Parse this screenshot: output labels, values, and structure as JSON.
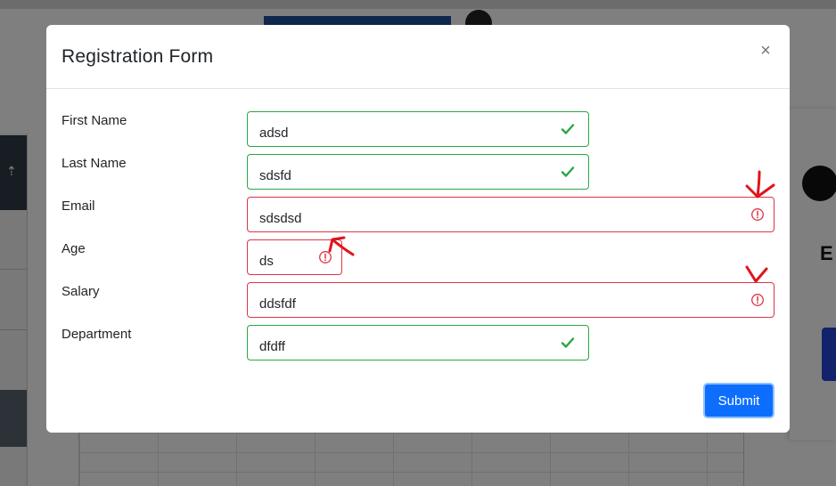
{
  "modal": {
    "title": "Registration Form",
    "close_label": "×",
    "submit_label": "Submit"
  },
  "fields": {
    "first_name": {
      "label": "First Name",
      "value": "adsd",
      "status": "valid"
    },
    "last_name": {
      "label": "Last Name",
      "value": "sdsfd",
      "status": "valid"
    },
    "email": {
      "label": "Email",
      "value": "sdsdsd",
      "status": "invalid"
    },
    "age": {
      "label": "Age",
      "value": "ds",
      "status": "invalid"
    },
    "salary": {
      "label": "Salary",
      "value": "ddsfdf",
      "status": "invalid"
    },
    "department": {
      "label": "Department",
      "value": "dfdff",
      "status": "valid"
    }
  },
  "icons": {
    "valid": "checkmark-icon",
    "invalid": "exclamation-circle-icon",
    "close": "close-icon",
    "annotation": "red-arrow-annotation"
  },
  "colors": {
    "valid": "#28a745",
    "invalid": "#dc3545",
    "primary": "#0d6efd",
    "annotation": "#e0141c"
  }
}
